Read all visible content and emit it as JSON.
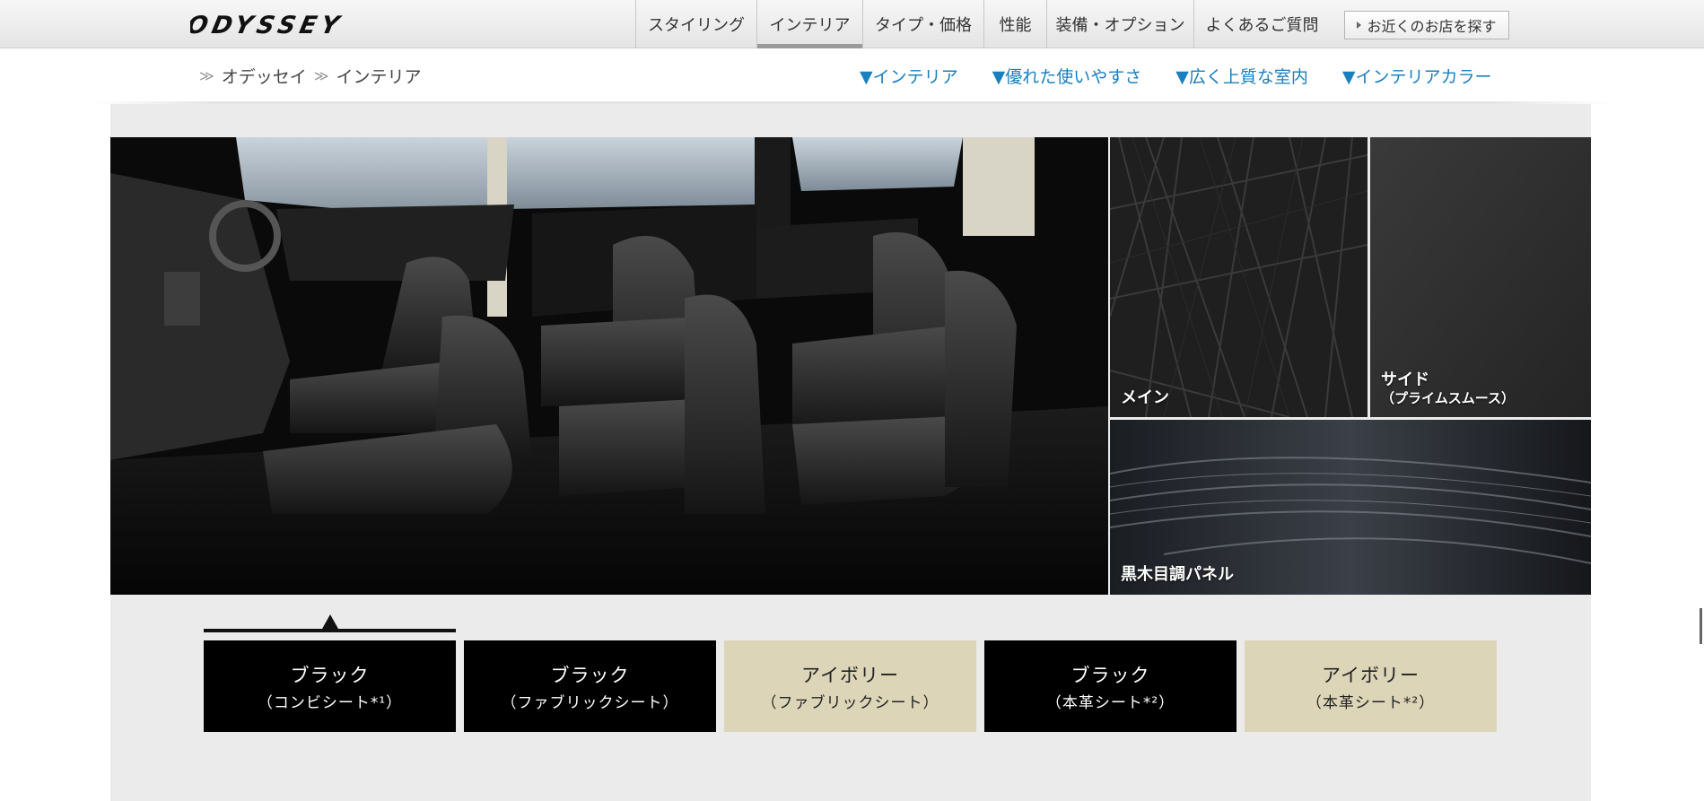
{
  "header": {
    "logo_text": "ODYSSEY",
    "nav": [
      {
        "label": "スタイリング",
        "active": false
      },
      {
        "label": "インテリア",
        "active": true
      },
      {
        "label": "タイプ・価格",
        "active": false
      },
      {
        "label": "性能",
        "active": false
      },
      {
        "label": "装備・オプション",
        "active": false
      },
      {
        "label": "よくあるご質問",
        "active": false
      }
    ],
    "shop_button": "お近くのお店を探す"
  },
  "subnav": {
    "breadcrumb": [
      "オデッセイ",
      "インテリア"
    ],
    "anchors": [
      "▼インテリア",
      "▼優れた使いやすさ",
      "▼広く上質な室内",
      "▼インテリアカラー"
    ]
  },
  "swatches": {
    "main": "メイン",
    "side": "サイド",
    "side_sub": "（プライムスムース）",
    "panel": "黒木目調パネル"
  },
  "options": [
    {
      "name": "ブラック",
      "sub": "（コンビシート*¹）",
      "theme": "black",
      "selected": true
    },
    {
      "name": "ブラック",
      "sub": "（ファブリックシート）",
      "theme": "black",
      "selected": false
    },
    {
      "name": "アイボリー",
      "sub": "（ファブリックシート）",
      "theme": "ivory",
      "selected": false
    },
    {
      "name": "ブラック",
      "sub": "（本革シート*²）",
      "theme": "black",
      "selected": false
    },
    {
      "name": "アイボリー",
      "sub": "（本革シート*²）",
      "theme": "ivory",
      "selected": false
    }
  ],
  "colors": {
    "link": "#1a7fbe",
    "black_option": "#000000",
    "ivory_option": "#dcd5b8",
    "content_bg": "#ebebeb"
  }
}
